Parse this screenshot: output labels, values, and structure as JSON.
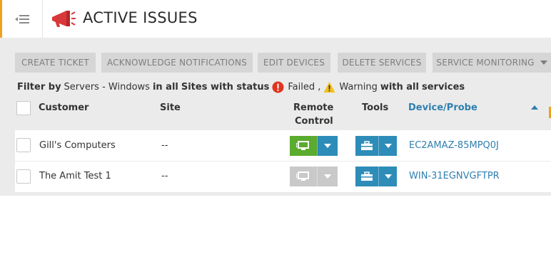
{
  "header": {
    "title": "ACTIVE ISSUES",
    "menu_icon": "menu-collapse-icon",
    "app_icon": "megaphone-icon"
  },
  "toolbar": {
    "buttons": [
      "CREATE TICKET",
      "ACKNOWLEDGE NOTIFICATIONS",
      "EDIT DEVICES",
      "DELETE SERVICES",
      "SERVICE MONITORING"
    ]
  },
  "filter": {
    "prefix": "Filter by",
    "type": "Servers - Windows",
    "in_all": "in all",
    "sites_with_status": "Sites with status",
    "failed": "Failed ,",
    "warning": "Warning",
    "with_all": "with all",
    "services": "services"
  },
  "table": {
    "columns": {
      "customer": "Customer",
      "site": "Site",
      "remote_line1": "Remote",
      "remote_line2": "Control",
      "tools": "Tools",
      "device": "Device/Probe"
    },
    "rows": [
      {
        "customer": "Gill's Computers",
        "site": "--",
        "device": "EC2AMAZ-85MPQ0J",
        "remote_enabled": true
      },
      {
        "customer": "The Amit Test 1",
        "site": "--",
        "device": "WIN-31EGNVGFTPR",
        "remote_enabled": false
      }
    ]
  },
  "colors": {
    "accent": "#f0a020",
    "remote_active": "#5aab2e",
    "remote_disabled": "#c9c9c9",
    "tools": "#2e8cb8",
    "link": "#2f7fb0"
  }
}
